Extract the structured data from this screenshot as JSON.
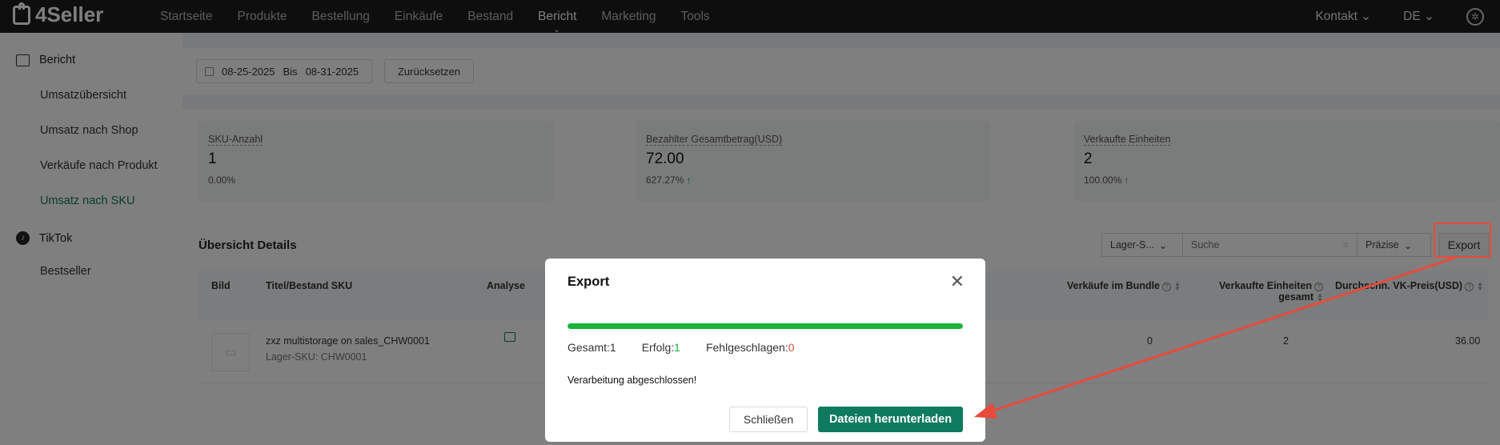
{
  "brand": {
    "name": "4Seller"
  },
  "nav": {
    "items": [
      "Startseite",
      "Produkte",
      "Bestellung",
      "Einkäufe",
      "Bestand",
      "Bericht",
      "Marketing",
      "Tools"
    ],
    "active": "Bericht",
    "right": {
      "contact": "Kontakt ⌄",
      "language": "DE ⌄"
    }
  },
  "sidebar": {
    "group_report": "Bericht",
    "report_items": [
      "Umsatzübersicht",
      "Umsatz nach Shop",
      "Verkäufe nach Produkt",
      "Umsatz nach SKU"
    ],
    "active_item": "Umsatz nach SKU",
    "group_tiktok": "TikTok",
    "tiktok_items": [
      "Bestseller"
    ]
  },
  "filter": {
    "date_from": "08-25-2025",
    "date_sep": "Bis",
    "date_to": "08-31-2025",
    "reset_label": "Zurücksetzen"
  },
  "cards": [
    {
      "label": "SKU-Anzahl",
      "value": "1",
      "pct": "0.00%",
      "trend": ""
    },
    {
      "label": "Bezahlter Gesamtbetrag(USD)",
      "value": "72.00",
      "pct": "627.27%",
      "trend": "↑"
    },
    {
      "label": "Verkaufte Einheiten",
      "value": "2",
      "pct": "100.00%",
      "trend": "↑"
    }
  ],
  "details": {
    "title": "Übersicht Details",
    "warehouse_select": "Lager-S...",
    "search_placeholder": "Suche",
    "precision_select": "Präzise",
    "export_label": "Export"
  },
  "table": {
    "headers": {
      "image": "Bild",
      "title": "Titel/Bestand SKU",
      "analysis": "Analyse",
      "bundle_sales": "Verkäufe im Bundle",
      "units_total_1": "Verkaufte Einheiten",
      "units_total_2": "gesamt",
      "avg_price": "Durchschn. VK-Preis(USD)"
    },
    "rows": [
      {
        "title": "zxz multistorage on sales_CHW0001",
        "sku": "Lager-SKU: CHW0001",
        "bundle_sales": "0",
        "units_total": "2",
        "avg_price": "36.00"
      }
    ]
  },
  "modal": {
    "title": "Export",
    "progress": 1.0,
    "total_label": "Gesamt",
    "total_value": "1",
    "success_label": "Erfolg",
    "success_value": "1",
    "failed_label": "Fehlgeschlagen",
    "failed_value": "0",
    "message": "Verarbeitung abgeschlossen!",
    "close_label": "Schließen",
    "download_label": "Dateien herunterladen"
  },
  "colors": {
    "accent": "#0e7a5f",
    "success": "#19b33a",
    "danger": "#e84b3c",
    "annotation": "#e84b3c"
  }
}
